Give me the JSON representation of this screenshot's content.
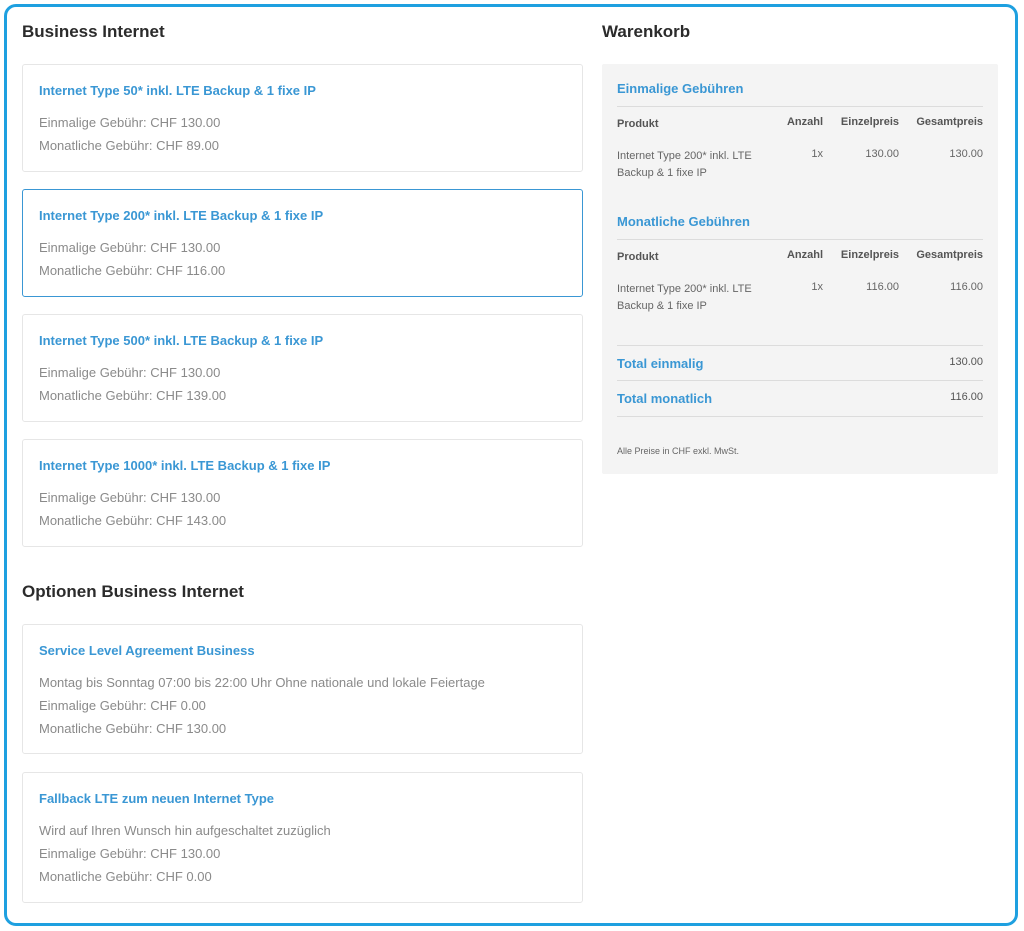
{
  "products": {
    "heading": "Business Internet",
    "items": [
      {
        "title": "Internet Type 50* inkl. LTE Backup & 1 fixe IP",
        "once": "Einmalige Gebühr: CHF 130.00",
        "monthly": "Monatliche Gebühr: CHF 89.00"
      },
      {
        "title": "Internet Type 200* inkl. LTE Backup & 1 fixe IP",
        "once": "Einmalige Gebühr: CHF 130.00",
        "monthly": "Monatliche Gebühr: CHF 116.00"
      },
      {
        "title": "Internet Type 500* inkl. LTE Backup & 1 fixe IP",
        "once": "Einmalige Gebühr: CHF 130.00",
        "monthly": "Monatliche Gebühr: CHF 139.00"
      },
      {
        "title": "Internet Type 1000* inkl. LTE Backup & 1 fixe IP",
        "once": "Einmalige Gebühr: CHF 130.00",
        "monthly": "Monatliche Gebühr: CHF 143.00"
      }
    ]
  },
  "options": {
    "heading": "Optionen Business Internet",
    "items": [
      {
        "title": "Service Level Agreement Business",
        "desc": "Montag bis Sonntag 07:00 bis 22:00 Uhr Ohne nationale und lokale Feiertage",
        "once": "Einmalige Gebühr: CHF 0.00",
        "monthly": "Monatliche Gebühr: CHF 130.00"
      },
      {
        "title": "Fallback LTE zum neuen Internet Type",
        "desc": "Wird auf Ihren Wunsch hin aufgeschaltet zuzüglich",
        "once": "Einmalige Gebühr: CHF 130.00",
        "monthly": "Monatliche Gebühr: CHF 0.00"
      }
    ]
  },
  "cart": {
    "heading": "Warenkorb",
    "columns": {
      "product": "Produkt",
      "qty": "Anzahl",
      "unit": "Einzelpreis",
      "total": "Gesamtpreis"
    },
    "once": {
      "heading": "Einmalige Gebühren",
      "row": {
        "product": "Internet Type 200* inkl. LTE Backup & 1 fixe IP",
        "qty": "1x",
        "unit": "130.00",
        "total": "130.00"
      }
    },
    "monthly": {
      "heading": "Monatliche Gebühren",
      "row": {
        "product": "Internet Type 200* inkl. LTE Backup & 1 fixe IP",
        "qty": "1x",
        "unit": "116.00",
        "total": "116.00"
      }
    },
    "total_once": {
      "label": "Total einmalig",
      "value": "130.00"
    },
    "total_monthly": {
      "label": "Total monatlich",
      "value": "116.00"
    },
    "note": "Alle Preise in CHF exkl. MwSt."
  },
  "colors": {
    "accent": "#3a97d4",
    "frame": "#1ea0e0",
    "cart_bg": "#f4f4f4"
  }
}
